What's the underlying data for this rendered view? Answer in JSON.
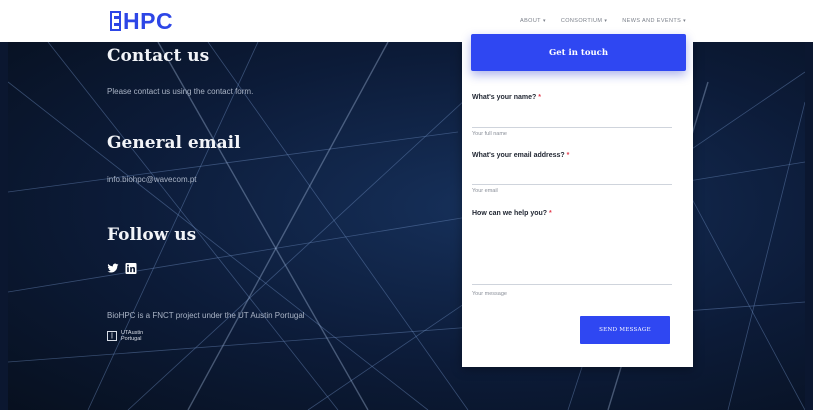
{
  "brand": {
    "logo_text": "HPC",
    "accent_color": "#2f47f2"
  },
  "nav": {
    "items": [
      {
        "label": "ABOUT"
      },
      {
        "label": "CONSORTIUM"
      },
      {
        "label": "NEWS AND EVENTS"
      }
    ],
    "caret": "▾"
  },
  "contact": {
    "heading": "Contact us",
    "text": "Please contact us using the contact form."
  },
  "general_email": {
    "heading": "General email",
    "address": "info.biohpc@wavecom.pt"
  },
  "follow": {
    "heading": "Follow us",
    "icons": [
      "twitter-icon",
      "linkedin-icon"
    ]
  },
  "project": {
    "text": "BioHPC is a FNCT project under the UT Austin Portugal",
    "ut_logo_line1": "UTAustin",
    "ut_logo_line2": "Portugal"
  },
  "form": {
    "header": "Get in touch",
    "name_label": "What's your name?",
    "name_placeholder": "Your full name",
    "email_label": "What's your email address?",
    "email_placeholder": "Your email",
    "help_label": "How can we help you?",
    "message_placeholder": "Your message",
    "required_mark": "*",
    "send_label": "SEND MESSAGE"
  }
}
